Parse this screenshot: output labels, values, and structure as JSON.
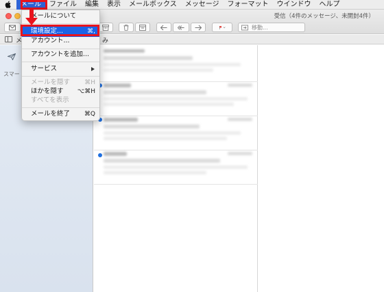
{
  "menubar": {
    "apple_icon": "apple-icon",
    "items": [
      "メール",
      "ファイル",
      "編集",
      "表示",
      "メールボックス",
      "メッセージ",
      "フォーマット",
      "ウインドウ",
      "ヘルプ"
    ],
    "active_index": 0
  },
  "window": {
    "title": "受信（4件のメッセージ、未開封4件）",
    "toolbar": {
      "move_label": "移動...",
      "icons": [
        "compose-icon",
        "archive-icon",
        "delete-icon",
        "junk-icon",
        "reply-icon",
        "reply-all-icon",
        "forward-icon",
        "flag-icon",
        "move-icon"
      ]
    }
  },
  "favorites": {
    "mailboxes_label": "メ",
    "second_label": "み"
  },
  "sidebar": {
    "smart_label": "スマー"
  },
  "mail_menu": {
    "items": [
      {
        "label": "メールについて",
        "shortcut": ""
      },
      {
        "label": "環境設定...",
        "shortcut": "⌘,"
      },
      {
        "label": "アカウント...",
        "shortcut": ""
      },
      {
        "label": "アカウントを追加...",
        "shortcut": ""
      },
      {
        "label": "サービス",
        "shortcut": ""
      },
      {
        "label": "メールを隠す",
        "shortcut": "⌘H"
      },
      {
        "label": "ほかを隠す",
        "shortcut": "⌥⌘H"
      },
      {
        "label": "すべてを表示",
        "shortcut": ""
      },
      {
        "label": "メールを終了",
        "shortcut": "⌘Q"
      }
    ],
    "highlighted_index": 1
  },
  "message_list": {
    "message_count": 4,
    "unread_indicator_color": "#1e6fe0"
  },
  "colors": {
    "annotation_red": "#e8141d",
    "menu_highlight": "#1c63e6",
    "menubar_active": "#2e63d6"
  }
}
